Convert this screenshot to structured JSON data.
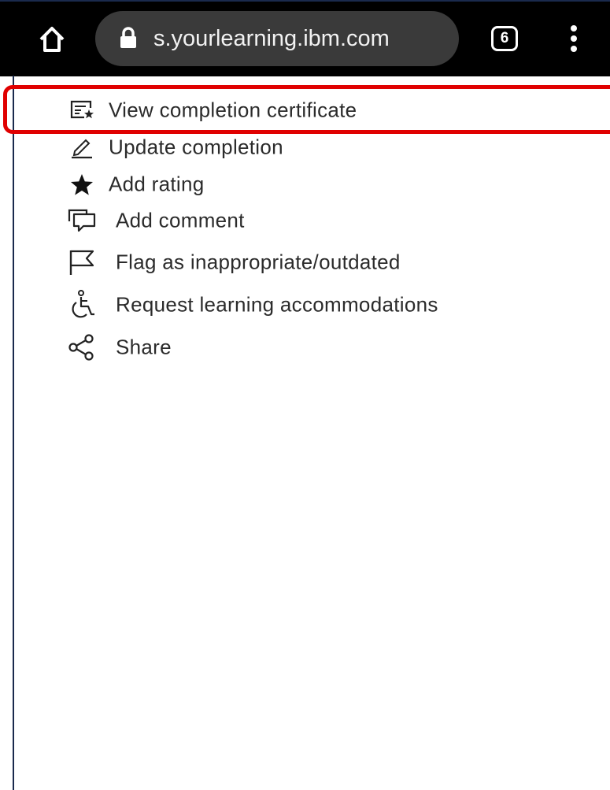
{
  "browser": {
    "home_icon": "home-icon",
    "url": "s.yourlearning.ibm.com",
    "tab_count": "6"
  },
  "menu": {
    "items": [
      {
        "label": "View completion certificate",
        "icon": "certificate-icon"
      },
      {
        "label": "Update completion",
        "icon": "edit-icon"
      },
      {
        "label": "Add rating",
        "icon": "star-icon"
      },
      {
        "label": "Add comment",
        "icon": "comment-icon"
      },
      {
        "label": "Flag as inappropriate/outdated",
        "icon": "flag-icon"
      },
      {
        "label": "Request learning accommodations",
        "icon": "accessibility-icon"
      },
      {
        "label": "Share",
        "icon": "share-icon"
      }
    ]
  },
  "colors": {
    "highlight": "#e00000",
    "topbar": "#000000",
    "url_pill": "#3a3a3a",
    "text": "#2b2b2b"
  }
}
